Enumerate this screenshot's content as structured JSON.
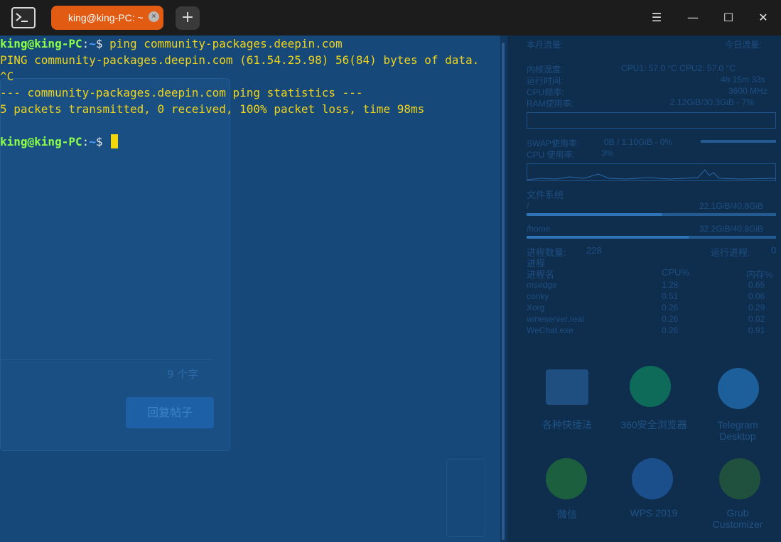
{
  "window": {
    "title": "king@king-PC: ~",
    "tab_close": "×",
    "add_tab": "+",
    "menu": "☰",
    "minimize": "—",
    "maximize": "☐",
    "close": "✕"
  },
  "terminal": {
    "lines": [
      {
        "type": "prompt",
        "user": "king@king-PC",
        "path": "~",
        "symbol": "$ ",
        "command": "ping community-packages.deepin.com"
      },
      {
        "type": "output",
        "text": "PING community-packages.deepin.com (61.54.25.98) 56(84) bytes of data."
      },
      {
        "type": "output",
        "text": "^C"
      },
      {
        "type": "output",
        "text": "--- community-packages.deepin.com ping statistics ---"
      },
      {
        "type": "output",
        "text": "5 packets transmitted, 0 received, 100% packet loss, time 98ms"
      },
      {
        "type": "blank",
        "text": ""
      },
      {
        "type": "prompt",
        "user": "king@king-PC",
        "path": "~",
        "symbol": "$ ",
        "command": ""
      }
    ],
    "prompt_separator": ":",
    "background_forum": {
      "char_count": "9 个字",
      "reply_button": "回复帖子"
    }
  },
  "desktop": {
    "conky": {
      "month_traffic": "本月流量:",
      "today_traffic": "今日流量:",
      "kernel_temp": "内核温度:",
      "cpu_temps": "CPU1: 57.0 °C   CPU2: 57.0 °C",
      "uptime_label": "运行时间:",
      "uptime": "4h 15m 33s",
      "cpu_freq_label": "CPU频率:",
      "cpu_freq": "3600 MHz",
      "ram_label": "RAM使用率:",
      "ram": "2.12GiB/30.3GiB - 7%",
      "swap_label": "SWAP使用率:",
      "swap": "0B / 1.10GiB - 0%",
      "cpu_usage_label": "CPU 使用率:",
      "cpu_usage": "3%",
      "fs_title": "文件系统",
      "fs_root": "/",
      "fs_root_usage": "22.1GiB/40.8GiB",
      "fs_home": "/home",
      "fs_home_usage": "32.2GiB/40.8GiB",
      "proc_count_label": "进程数量:",
      "proc_count": "228",
      "running_label": "运行进程:",
      "running": "0",
      "proc_title": "进程",
      "proc_headers": [
        "进程名",
        "CPU%",
        "内存%"
      ],
      "processes": [
        {
          "name": "msedge",
          "cpu": "1.28",
          "mem": "0.65"
        },
        {
          "name": "conky",
          "cpu": "0.51",
          "mem": "0.06"
        },
        {
          "name": "Xorg",
          "cpu": "0.26",
          "mem": "0.29"
        },
        {
          "name": "wineserver.real",
          "cpu": "0.26",
          "mem": "0.02"
        },
        {
          "name": "WeChat.exe",
          "cpu": "0.26",
          "mem": "0.91"
        }
      ]
    },
    "icons": [
      {
        "label": "各种快捷法"
      },
      {
        "label": "360安全浏览器"
      },
      {
        "label": "Telegram Desktop"
      },
      {
        "label": "微信"
      },
      {
        "label": "WPS 2019"
      },
      {
        "label": "Grub Customizer"
      }
    ]
  },
  "colors": {
    "tab_active": "#e25b13",
    "terminal_bg": "#16497a",
    "prompt_user": "#8cff4a",
    "prompt_path": "#4ea2ff",
    "output_text": "#f0d41c",
    "cursor": "#f2d70c"
  }
}
